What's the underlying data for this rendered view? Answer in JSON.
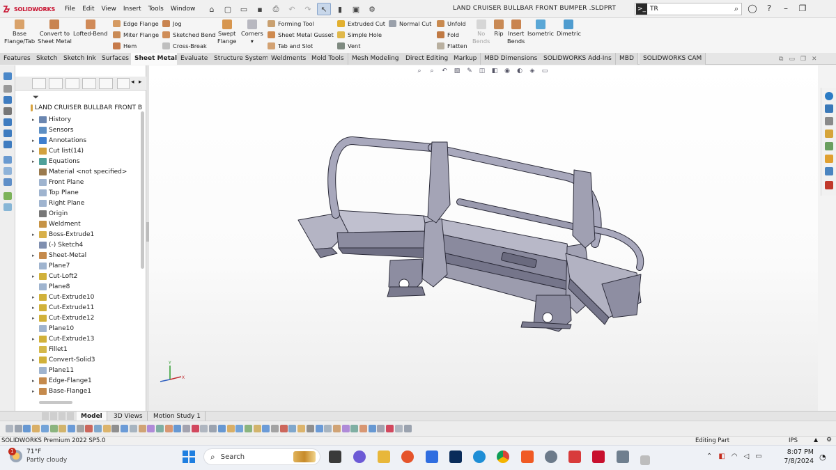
{
  "app": {
    "brand": "SOLIDWORKS",
    "document_title": "LAND CRUISER BULLBAR FRONT BUMPER .SLDPRT"
  },
  "menu": [
    "File",
    "Edit",
    "View",
    "Insert",
    "Tools",
    "Window"
  ],
  "search": {
    "prefix": ">_",
    "value": "TR"
  },
  "commands": {
    "base_flange": "Base\nFlange/Tab",
    "convert": "Convert to\nSheet Metal",
    "lofted_bend": "Lofted-Bend",
    "edge_flange": "Edge Flange",
    "miter_flange": "Miter Flange",
    "hem": "Hem",
    "jog": "Jog",
    "sketched_bend": "Sketched Bend",
    "cross_break": "Cross-Break",
    "swept_flange": "Swept\nFlange",
    "corners": "Corners",
    "forming_tool": "Forming Tool",
    "sheet_metal_gusset": "Sheet Metal Gusset",
    "tab_and_slot": "Tab and Slot",
    "extruded_cut": "Extruded Cut",
    "simple_hole": "Simple Hole",
    "vent": "Vent",
    "normal_cut": "Normal Cut",
    "unfold": "Unfold",
    "fold": "Fold",
    "flatten": "Flatten",
    "no_bends": "No\nBends",
    "rip": "Rip",
    "insert_bends": "Insert\nBends",
    "isometric": "Isometric",
    "dimetric": "Dimetric"
  },
  "tabs": [
    "Features",
    "Sketch",
    "Sketch Ink",
    "Surfaces",
    "Sheet Metal",
    "Evaluate",
    "Structure System",
    "Weldments",
    "Mold Tools",
    "Mesh Modeling",
    "Direct Editing",
    "Markup",
    "MBD Dimensions",
    "SOLIDWORKS Add-Ins",
    "MBD",
    "SOLIDWORKS CAM"
  ],
  "active_tab": "Sheet Metal",
  "tree": {
    "root": "LAND CRUISER BULLBAR FRONT B",
    "items": [
      {
        "label": "History",
        "arrow": true
      },
      {
        "label": "Sensors",
        "arrow": false
      },
      {
        "label": "Annotations",
        "arrow": true
      },
      {
        "label": "Cut list(14)",
        "arrow": true
      },
      {
        "label": "Equations",
        "arrow": true
      },
      {
        "label": "Material <not specified>",
        "arrow": false
      },
      {
        "label": "Front Plane",
        "arrow": false
      },
      {
        "label": "Top Plane",
        "arrow": false
      },
      {
        "label": "Right Plane",
        "arrow": false
      },
      {
        "label": "Origin",
        "arrow": false
      },
      {
        "label": "Weldment",
        "arrow": false
      },
      {
        "label": "Boss-Extrude1",
        "arrow": true
      },
      {
        "label": "(-) Sketch4",
        "arrow": false
      },
      {
        "label": "Sheet-Metal",
        "arrow": true
      },
      {
        "label": "Plane7",
        "arrow": false
      },
      {
        "label": "Cut-Loft2",
        "arrow": true
      },
      {
        "label": "Plane8",
        "arrow": false
      },
      {
        "label": "Cut-Extrude10",
        "arrow": true
      },
      {
        "label": "Cut-Extrude11",
        "arrow": true
      },
      {
        "label": "Cut-Extrude12",
        "arrow": true
      },
      {
        "label": "Plane10",
        "arrow": false
      },
      {
        "label": "Cut-Extrude13",
        "arrow": true
      },
      {
        "label": "Fillet1",
        "arrow": false
      },
      {
        "label": "Convert-Solid3",
        "arrow": true
      },
      {
        "label": "Plane11",
        "arrow": false
      },
      {
        "label": "Edge-Flange1",
        "arrow": true
      },
      {
        "label": "Base-Flange1",
        "arrow": true
      }
    ]
  },
  "bottom_tabs": [
    "Model",
    "3D Views",
    "Motion Study 1"
  ],
  "active_bottom_tab": "Model",
  "status": {
    "version": "SOLIDWORKS Premium 2022 SP5.0",
    "mode": "Editing Part",
    "units": "IPS",
    "caret": "▲"
  },
  "triad": {
    "y": "Y",
    "x": "X"
  },
  "taskbar": {
    "weather_temp": "71°F",
    "weather_cond": "Partly cloudy",
    "weather_badge": "1",
    "search_label": "Search",
    "time": "8:07 PM",
    "date": "7/8/2024"
  },
  "colors": {
    "accent": "#c8102e",
    "part_body": "#9a9aad",
    "part_edge": "#2c2c3a"
  }
}
